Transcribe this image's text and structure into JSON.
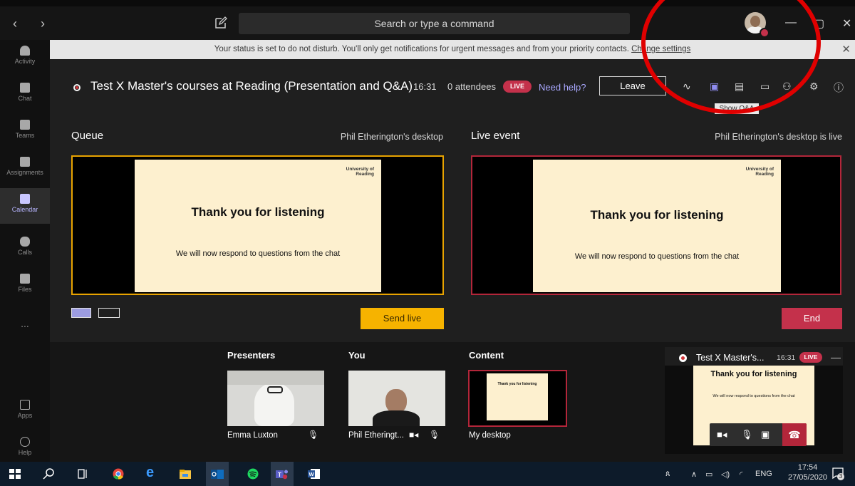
{
  "titlebar": {
    "back_icon": "chevron-left-icon",
    "forward_icon": "chevron-right-icon",
    "compose_icon": "compose-icon",
    "search_placeholder": "Search or type a command",
    "minimize": "—",
    "maximize": "▢",
    "close": "✕"
  },
  "banner": {
    "message": "Your status is set to do not disturb. You'll only get notifications for urgent messages and from your priority contacts. ",
    "link": "Change settings",
    "close": "✕"
  },
  "rail": {
    "items": [
      {
        "label": "Activity"
      },
      {
        "label": "Chat"
      },
      {
        "label": "Teams"
      },
      {
        "label": "Assignments"
      },
      {
        "label": "Calendar"
      },
      {
        "label": "Calls"
      },
      {
        "label": "Files"
      },
      {
        "label": "..."
      },
      {
        "label": "Apps"
      },
      {
        "label": "Help"
      }
    ],
    "active": "Calendar"
  },
  "meeting": {
    "title": "Test X Master's courses at Reading (Presentation and Q&A)",
    "time": "16:31",
    "attendees": "0 attendees",
    "live_badge": "LIVE",
    "need_help": "Need help?",
    "leave": "Leave",
    "tooltip": "Show Q&A"
  },
  "queue": {
    "label": "Queue",
    "source": "Phil Etherington's desktop",
    "send_live": "Send live"
  },
  "live": {
    "label": "Live event",
    "source": "Phil Etherington's desktop is live",
    "end": "End"
  },
  "slide": {
    "logo": "University of Reading",
    "title": "Thank you for listening",
    "subtitle": "We will now respond to questions from the chat"
  },
  "strip": {
    "presenters_label": "Presenters",
    "you_label": "You",
    "content_label": "Content",
    "presenter_name": "Emma Luxton",
    "you_name": "Phil Etheringt...",
    "content_name": "My desktop"
  },
  "mini": {
    "title": "Test X Master's...",
    "time": "16:31",
    "live": "LIVE",
    "slide_title": "Thank you for listening",
    "slide_sub": "We will now respond to questions from the chat"
  },
  "taskbar": {
    "lang": "ENG",
    "time": "17:54",
    "date": "27/05/2020",
    "notifications": "3"
  },
  "colors": {
    "accent": "#6264a7",
    "live_red": "#c4314b",
    "queue_border": "#e8a300",
    "send_live": "#f6b300"
  }
}
